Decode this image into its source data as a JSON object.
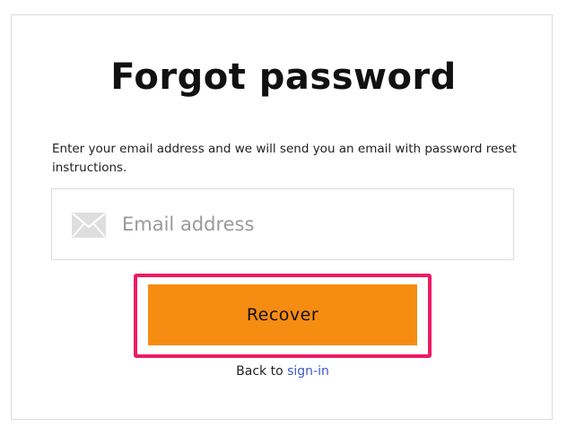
{
  "page": {
    "title": "Forgot password",
    "instructions": "Enter your email address and we will send you an email with password reset instructions."
  },
  "email_field": {
    "icon": "mail-icon",
    "placeholder": "Email address",
    "value": ""
  },
  "recover_button": {
    "label": "Recover"
  },
  "back_link": {
    "prefix": "Back to",
    "link_label": "sign-in"
  },
  "colors": {
    "button_background": "#f78c12",
    "highlight_border": "#ee1b64",
    "link": "#3a5bc7",
    "card_border": "#dcdcdc"
  }
}
